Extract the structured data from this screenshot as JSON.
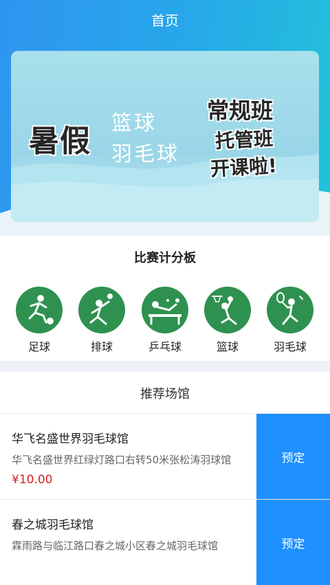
{
  "header": {
    "title": "首页"
  },
  "banner": {
    "headline": "暑假",
    "sport1": "篮球",
    "sport2": "羽毛球",
    "right1": "常规班",
    "right2": "托管班",
    "right3": "开课啦!"
  },
  "scoreboard": {
    "title": "比赛计分板",
    "sports": [
      {
        "label": "足球",
        "icon": "soccer-icon"
      },
      {
        "label": "排球",
        "icon": "volleyball-icon"
      },
      {
        "label": "乒乓球",
        "icon": "table-tennis-icon"
      },
      {
        "label": "篮球",
        "icon": "basketball-icon"
      },
      {
        "label": "羽毛球",
        "icon": "badminton-icon"
      }
    ],
    "icon_color": "#2f9150"
  },
  "venues": {
    "title": "推荐场馆",
    "items": [
      {
        "name": "华飞名盛世界羽毛球馆",
        "address": "华飞名盛世界红绿灯路口右转50米张松涛羽球馆",
        "price": "¥10.00",
        "button": "预定"
      },
      {
        "name": "春之城羽毛球馆",
        "address": "霖雨路与临江路口春之城小区春之城羽毛球馆",
        "price": "",
        "button": "预定"
      }
    ]
  },
  "colors": {
    "header_start": "#2f95f0",
    "header_end": "#22c3d8",
    "book_button": "#1e90ff",
    "price": "#d32222"
  }
}
